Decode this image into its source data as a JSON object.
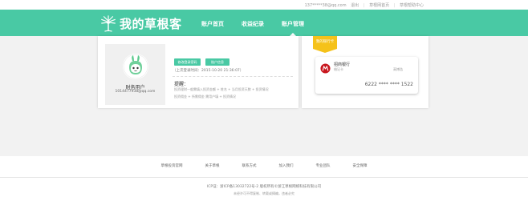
{
  "topbar": {
    "user_text": "137*****38@qq.com",
    "logout": "退出",
    "home_link": "草根网首页",
    "help_link": "草根帮助中心"
  },
  "header": {
    "logo_text": "我的草根客",
    "nav": [
      {
        "label": "账户首页",
        "active": false
      },
      {
        "label": "收益纪录",
        "active": false
      },
      {
        "label": "账户管理",
        "active": true
      }
    ],
    "brand_color": "#49c9a4"
  },
  "profile": {
    "user_name": "财务用户",
    "user_email": "1014477938@qq.com",
    "buttons": [
      "修改登录密码",
      "账户信息"
    ],
    "last_login": "（上次登录时间：2015-10-20 21:36:07）",
    "tip_title": "提醒：",
    "tip_line1": "投资理财一般需填入投资金额 + 姓名 + 当月投资天数 + 投资情况",
    "tip_line2": "投资佣金 + 所需佣金 需用户填 + 投资情况"
  },
  "bank": {
    "ribbon_label": "我的银行卡",
    "bank_name": "招商银行",
    "card_type": "借记卡",
    "card_holder": "高博浩",
    "card_number": "6222 **** **** 1522",
    "accent_color": "#f5c21a",
    "logo_color": "#c8161d"
  },
  "footer": {
    "links": [
      "草根投资官网",
      "关于草根",
      "联系方式",
      "加入我们",
      "专业团队",
      "安全保障"
    ],
    "icp": "ICP证：浙ICP备13032722号-2 版权所有©浙江草根网络科技有限公司",
    "copyright": "未经许可不得复制、转载或摘编，违者必究"
  }
}
